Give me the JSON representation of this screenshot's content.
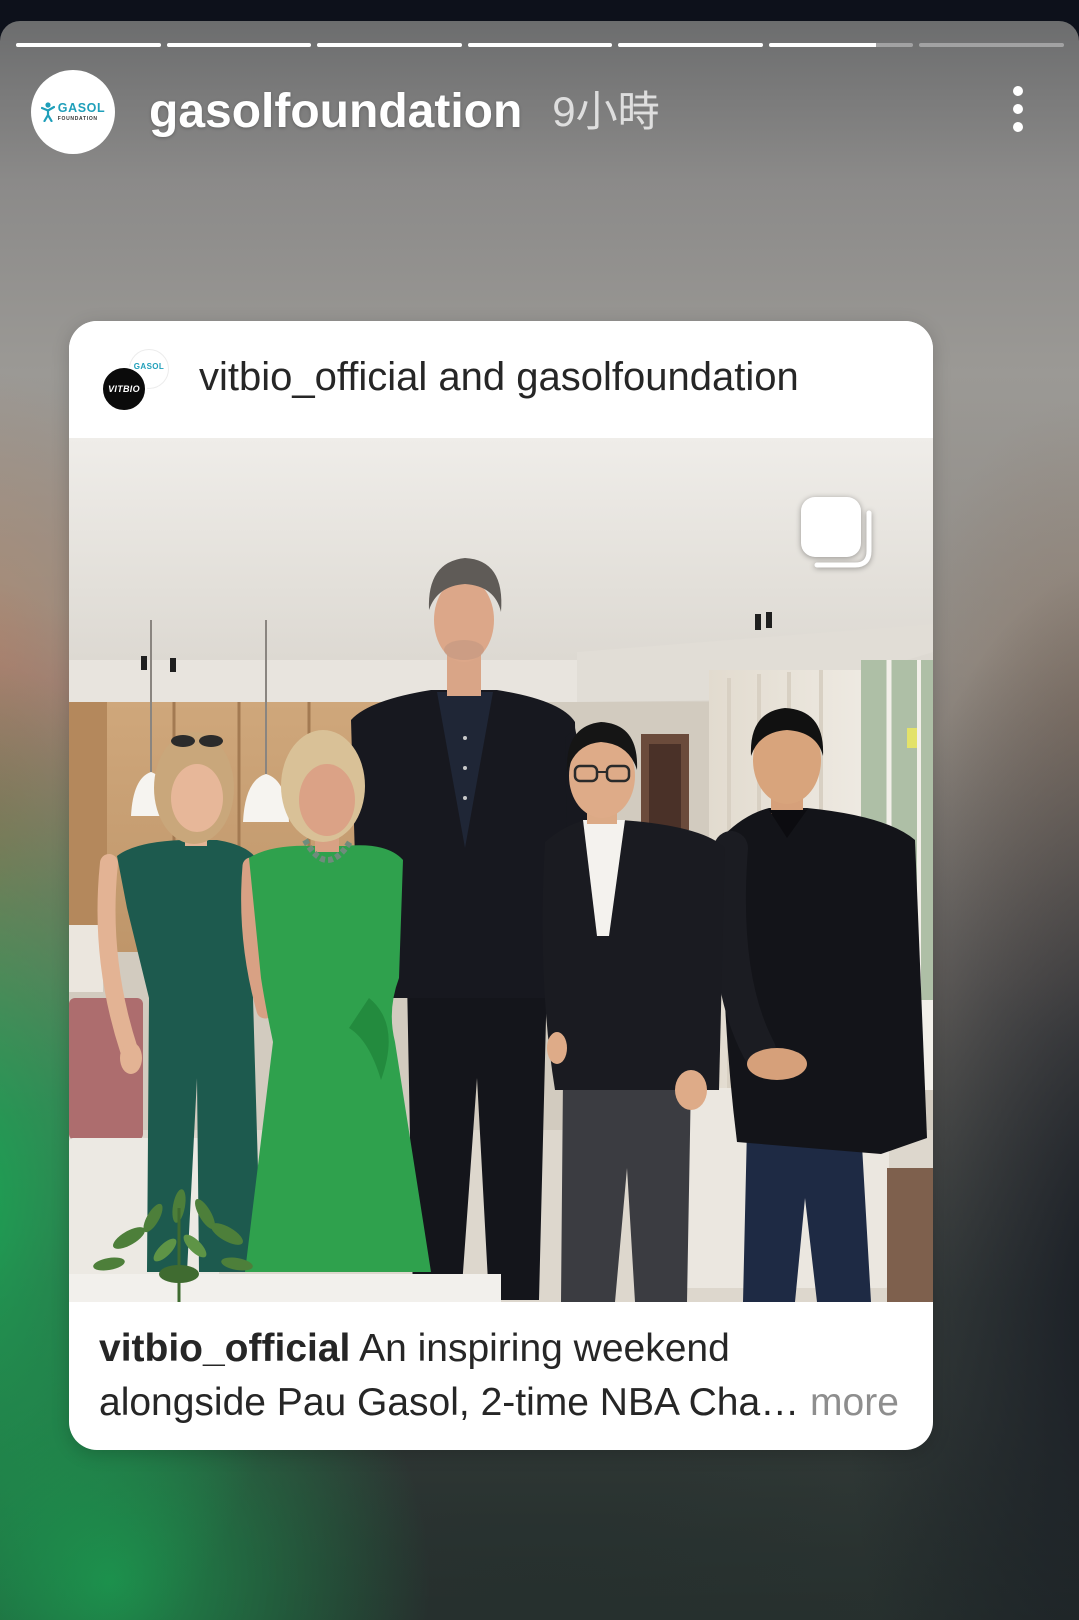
{
  "story": {
    "progress_segments": [
      1,
      1,
      1,
      1,
      1,
      0.74,
      0
    ],
    "account": {
      "username": "gasolfoundation",
      "time_ago": "9小時",
      "avatar_logo": {
        "name": "GASOL",
        "tagline": "FOUNDATION"
      }
    },
    "icons": {
      "more": "more-vertical-icon",
      "logo_figure": "person-figure-icon"
    }
  },
  "shared_post": {
    "header": {
      "authors": "vitbio_official and gasolfoundation",
      "avatar_front_text": "VITBIO",
      "avatar_back_text": "GASOL"
    },
    "media": {
      "carousel_icon": "carousel-multiple-icon"
    },
    "caption": {
      "username": "vitbio_official",
      "line1": "An inspiring weekend",
      "line2": "alongside Pau Gasol, 2-time NBA Cha…",
      "more_label": "more"
    }
  },
  "colors": {
    "brand_teal": "#1f9fba",
    "caption_text": "#262626",
    "muted_text": "#8e8e8e",
    "progress_track": "rgba(255,255,255,0.35)",
    "progress_fill": "#ffffff"
  }
}
